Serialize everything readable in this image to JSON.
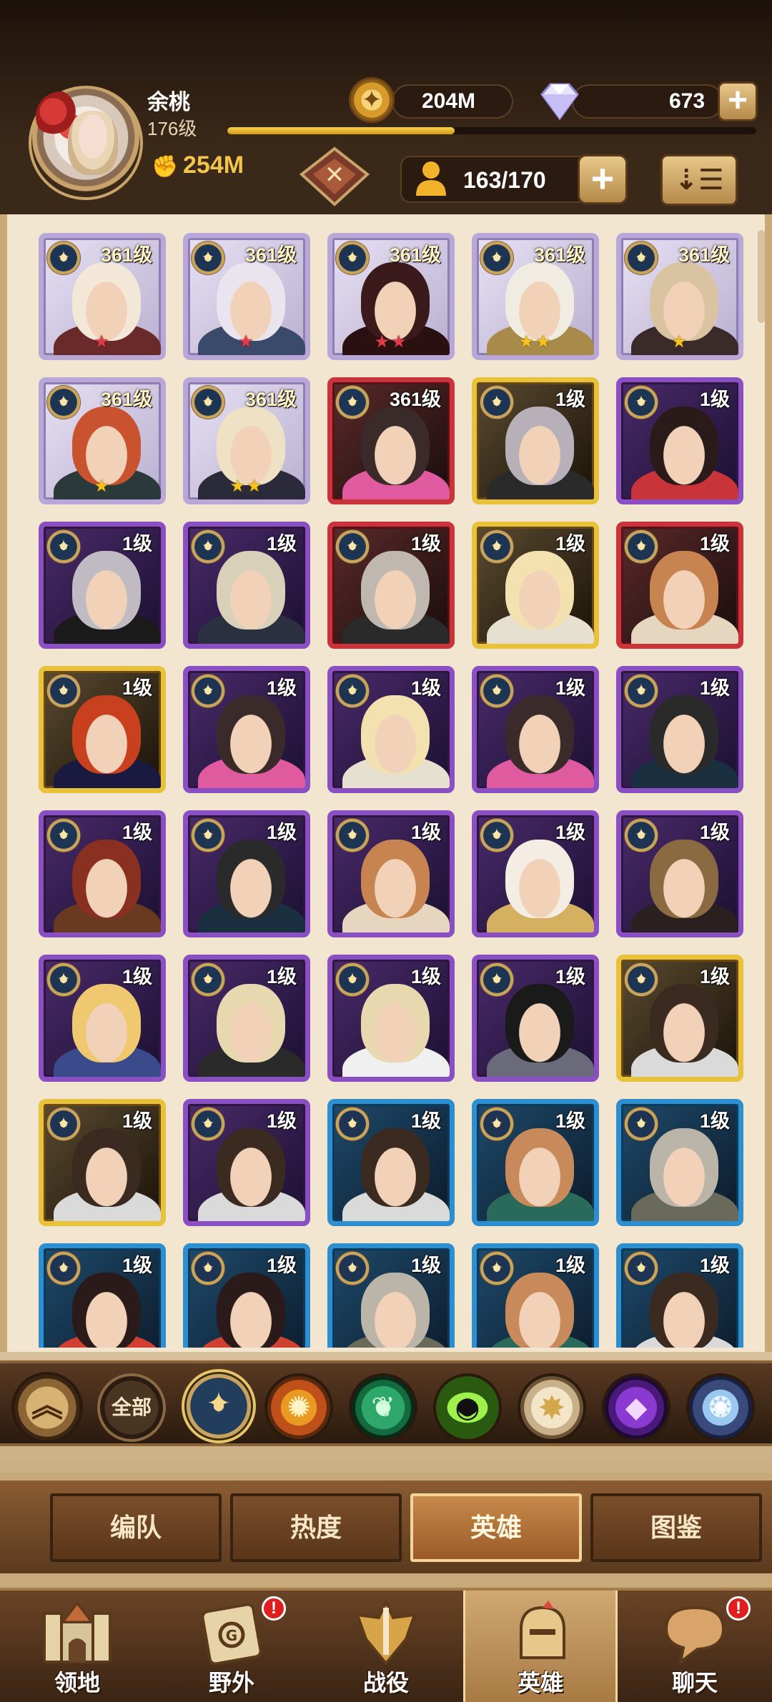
{
  "player": {
    "name": "余桃",
    "level": "176级",
    "power": "254M",
    "exp_progress_fraction": 0.43
  },
  "currency": {
    "gold": "204M",
    "gems": "673",
    "add_symbol": "+"
  },
  "roster": {
    "capacity": "163/170",
    "add_symbol": "+"
  },
  "heroes": [
    {
      "level": "361级",
      "stars": "★",
      "star_color": "red",
      "rarity": "white"
    },
    {
      "level": "361级",
      "stars": "★",
      "star_color": "red",
      "rarity": "white"
    },
    {
      "level": "361级",
      "stars": "★★",
      "star_color": "red",
      "rarity": "white"
    },
    {
      "level": "361级",
      "stars": "★★",
      "star_color": "gold",
      "rarity": "white"
    },
    {
      "level": "361级",
      "stars": "★",
      "star_color": "gold",
      "rarity": "white"
    },
    {
      "level": "361级",
      "stars": "★",
      "star_color": "gold",
      "rarity": "white"
    },
    {
      "level": "361级",
      "stars": "★★",
      "star_color": "gold",
      "rarity": "white"
    },
    {
      "level": "361级",
      "stars": "",
      "star_color": "gold",
      "rarity": "red"
    },
    {
      "level": "1级",
      "stars": "",
      "star_color": "gold",
      "rarity": "gold"
    },
    {
      "level": "1级",
      "stars": "",
      "star_color": "gold",
      "rarity": "purple"
    },
    {
      "level": "1级",
      "stars": "",
      "star_color": "gold",
      "rarity": "purple"
    },
    {
      "level": "1级",
      "stars": "",
      "star_color": "gold",
      "rarity": "purple"
    },
    {
      "level": "1级",
      "stars": "",
      "star_color": "gold",
      "rarity": "red"
    },
    {
      "level": "1级",
      "stars": "",
      "star_color": "gold",
      "rarity": "gold"
    },
    {
      "level": "1级",
      "stars": "",
      "star_color": "gold",
      "rarity": "red"
    },
    {
      "level": "1级",
      "stars": "",
      "star_color": "gold",
      "rarity": "gold"
    },
    {
      "level": "1级",
      "stars": "",
      "star_color": "gold",
      "rarity": "purple"
    },
    {
      "level": "1级",
      "stars": "",
      "star_color": "gold",
      "rarity": "purple"
    },
    {
      "level": "1级",
      "stars": "",
      "star_color": "gold",
      "rarity": "purple"
    },
    {
      "level": "1级",
      "stars": "",
      "star_color": "gold",
      "rarity": "purple"
    },
    {
      "level": "1级",
      "stars": "",
      "star_color": "gold",
      "rarity": "purple"
    },
    {
      "level": "1级",
      "stars": "",
      "star_color": "gold",
      "rarity": "purple"
    },
    {
      "level": "1级",
      "stars": "",
      "star_color": "gold",
      "rarity": "purple"
    },
    {
      "level": "1级",
      "stars": "",
      "star_color": "gold",
      "rarity": "purple"
    },
    {
      "level": "1级",
      "stars": "",
      "star_color": "gold",
      "rarity": "purple"
    },
    {
      "level": "1级",
      "stars": "",
      "star_color": "gold",
      "rarity": "purple"
    },
    {
      "level": "1级",
      "stars": "",
      "star_color": "gold",
      "rarity": "purple"
    },
    {
      "level": "1级",
      "stars": "",
      "star_color": "gold",
      "rarity": "purple"
    },
    {
      "level": "1级",
      "stars": "",
      "star_color": "gold",
      "rarity": "purple"
    },
    {
      "level": "1级",
      "stars": "",
      "star_color": "gold",
      "rarity": "gold"
    },
    {
      "level": "1级",
      "stars": "",
      "star_color": "gold",
      "rarity": "gold"
    },
    {
      "level": "1级",
      "stars": "",
      "star_color": "gold",
      "rarity": "purple"
    },
    {
      "level": "1级",
      "stars": "",
      "star_color": "gold",
      "rarity": "blue"
    },
    {
      "level": "1级",
      "stars": "",
      "star_color": "gold",
      "rarity": "blue"
    },
    {
      "level": "1级",
      "stars": "",
      "star_color": "gold",
      "rarity": "blue"
    },
    {
      "level": "1级",
      "stars": "",
      "star_color": "gold",
      "rarity": "blue"
    },
    {
      "level": "1级",
      "stars": "",
      "star_color": "gold",
      "rarity": "blue"
    },
    {
      "level": "1级",
      "stars": "",
      "star_color": "gold",
      "rarity": "blue"
    },
    {
      "level": "1级",
      "stars": "",
      "star_color": "gold",
      "rarity": "blue"
    },
    {
      "level": "1级",
      "stars": "",
      "star_color": "gold",
      "rarity": "blue"
    }
  ],
  "filters": [
    {
      "name": "collapse-up",
      "glyph": "︽"
    },
    {
      "name": "all",
      "glyph": "全部"
    },
    {
      "name": "lightbearer",
      "glyph": "✦"
    },
    {
      "name": "mauler",
      "glyph": "✺"
    },
    {
      "name": "wilder",
      "glyph": "❦"
    },
    {
      "name": "graveborn",
      "glyph": "◉"
    },
    {
      "name": "celestial",
      "glyph": "✸"
    },
    {
      "name": "hypogean",
      "glyph": "◆"
    },
    {
      "name": "dimensional",
      "glyph": "❂"
    }
  ],
  "sub_tabs": [
    "编队",
    "热度",
    "英雄",
    "图鉴"
  ],
  "sub_tab_active_index": 2,
  "nav": [
    {
      "label": "领地",
      "badge": ""
    },
    {
      "label": "野外",
      "badge": "!"
    },
    {
      "label": "战役",
      "badge": ""
    },
    {
      "label": "英雄",
      "badge": ""
    },
    {
      "label": "聊天",
      "badge": "!"
    }
  ],
  "nav_active_index": 3
}
